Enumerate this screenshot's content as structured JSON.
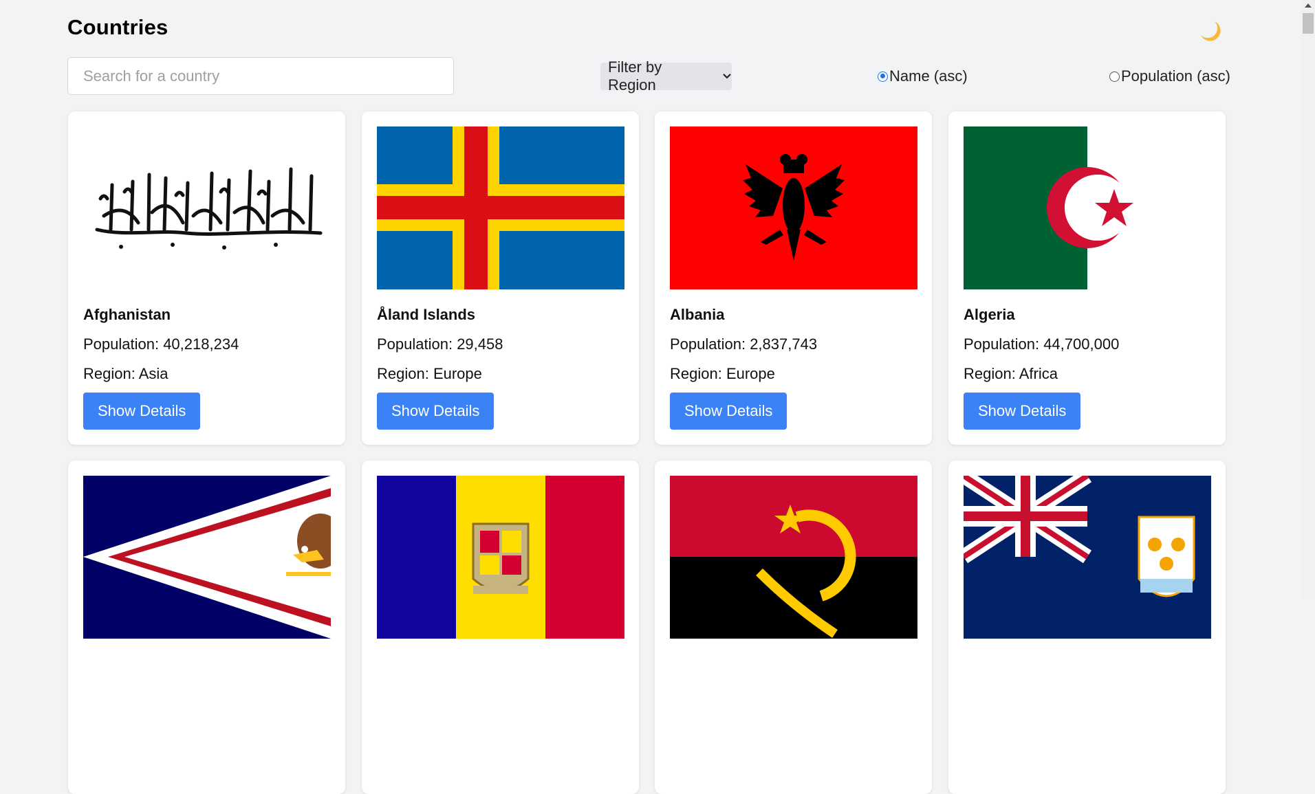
{
  "header": {
    "title": "Countries",
    "theme_icon": "crescent-moon-icon",
    "theme_color": "#f6b93b"
  },
  "search": {
    "placeholder": "Search for a country",
    "value": ""
  },
  "filter": {
    "label": "Filter by Region",
    "icon": "chevron-down-icon"
  },
  "sort": {
    "options": [
      {
        "label": "Name (asc)",
        "checked": true
      },
      {
        "label": "Population (asc)",
        "checked": false
      }
    ]
  },
  "countries": [
    {
      "name": "Afghanistan",
      "population": "Population: 40,218,234",
      "region": "Region: Asia",
      "button": "Show Details",
      "flag": "afghanistan-flag"
    },
    {
      "name": "Åland Islands",
      "population": "Population: 29,458",
      "region": "Region: Europe",
      "button": "Show Details",
      "flag": "aland-islands-flag"
    },
    {
      "name": "Albania",
      "population": "Population: 2,837,743",
      "region": "Region: Europe",
      "button": "Show Details",
      "flag": "albania-flag"
    },
    {
      "name": "Algeria",
      "population": "Population: 44,700,000",
      "region": "Region: Africa",
      "button": "Show Details",
      "flag": "algeria-flag"
    },
    {
      "flag": "american-samoa-flag"
    },
    {
      "flag": "andorra-flag"
    },
    {
      "flag": "angola-flag"
    },
    {
      "flag": "anguilla-flag"
    }
  ],
  "colors": {
    "button": "#3b82f6",
    "radio_accent": "#1a73e8",
    "background": "#f2f3f5"
  }
}
